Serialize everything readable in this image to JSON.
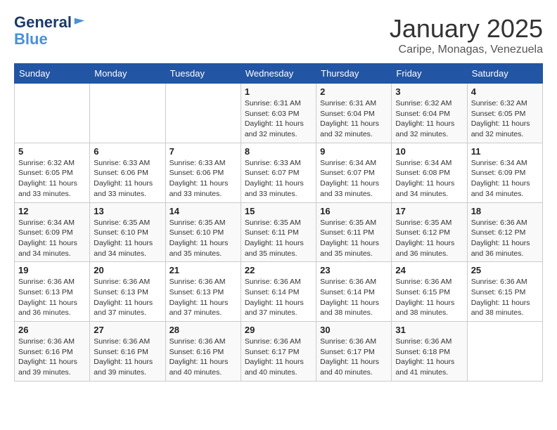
{
  "logo": {
    "line1": "General",
    "line2": "Blue"
  },
  "title": "January 2025",
  "subtitle": "Caripe, Monagas, Venezuela",
  "days_of_week": [
    "Sunday",
    "Monday",
    "Tuesday",
    "Wednesday",
    "Thursday",
    "Friday",
    "Saturday"
  ],
  "weeks": [
    [
      {
        "day": "",
        "info": ""
      },
      {
        "day": "",
        "info": ""
      },
      {
        "day": "",
        "info": ""
      },
      {
        "day": "1",
        "info": "Sunrise: 6:31 AM\nSunset: 6:03 PM\nDaylight: 11 hours\nand 32 minutes."
      },
      {
        "day": "2",
        "info": "Sunrise: 6:31 AM\nSunset: 6:04 PM\nDaylight: 11 hours\nand 32 minutes."
      },
      {
        "day": "3",
        "info": "Sunrise: 6:32 AM\nSunset: 6:04 PM\nDaylight: 11 hours\nand 32 minutes."
      },
      {
        "day": "4",
        "info": "Sunrise: 6:32 AM\nSunset: 6:05 PM\nDaylight: 11 hours\nand 32 minutes."
      }
    ],
    [
      {
        "day": "5",
        "info": "Sunrise: 6:32 AM\nSunset: 6:05 PM\nDaylight: 11 hours\nand 33 minutes."
      },
      {
        "day": "6",
        "info": "Sunrise: 6:33 AM\nSunset: 6:06 PM\nDaylight: 11 hours\nand 33 minutes."
      },
      {
        "day": "7",
        "info": "Sunrise: 6:33 AM\nSunset: 6:06 PM\nDaylight: 11 hours\nand 33 minutes."
      },
      {
        "day": "8",
        "info": "Sunrise: 6:33 AM\nSunset: 6:07 PM\nDaylight: 11 hours\nand 33 minutes."
      },
      {
        "day": "9",
        "info": "Sunrise: 6:34 AM\nSunset: 6:07 PM\nDaylight: 11 hours\nand 33 minutes."
      },
      {
        "day": "10",
        "info": "Sunrise: 6:34 AM\nSunset: 6:08 PM\nDaylight: 11 hours\nand 34 minutes."
      },
      {
        "day": "11",
        "info": "Sunrise: 6:34 AM\nSunset: 6:09 PM\nDaylight: 11 hours\nand 34 minutes."
      }
    ],
    [
      {
        "day": "12",
        "info": "Sunrise: 6:34 AM\nSunset: 6:09 PM\nDaylight: 11 hours\nand 34 minutes."
      },
      {
        "day": "13",
        "info": "Sunrise: 6:35 AM\nSunset: 6:10 PM\nDaylight: 11 hours\nand 34 minutes."
      },
      {
        "day": "14",
        "info": "Sunrise: 6:35 AM\nSunset: 6:10 PM\nDaylight: 11 hours\nand 35 minutes."
      },
      {
        "day": "15",
        "info": "Sunrise: 6:35 AM\nSunset: 6:11 PM\nDaylight: 11 hours\nand 35 minutes."
      },
      {
        "day": "16",
        "info": "Sunrise: 6:35 AM\nSunset: 6:11 PM\nDaylight: 11 hours\nand 35 minutes."
      },
      {
        "day": "17",
        "info": "Sunrise: 6:35 AM\nSunset: 6:12 PM\nDaylight: 11 hours\nand 36 minutes."
      },
      {
        "day": "18",
        "info": "Sunrise: 6:36 AM\nSunset: 6:12 PM\nDaylight: 11 hours\nand 36 minutes."
      }
    ],
    [
      {
        "day": "19",
        "info": "Sunrise: 6:36 AM\nSunset: 6:13 PM\nDaylight: 11 hours\nand 36 minutes."
      },
      {
        "day": "20",
        "info": "Sunrise: 6:36 AM\nSunset: 6:13 PM\nDaylight: 11 hours\nand 37 minutes."
      },
      {
        "day": "21",
        "info": "Sunrise: 6:36 AM\nSunset: 6:13 PM\nDaylight: 11 hours\nand 37 minutes."
      },
      {
        "day": "22",
        "info": "Sunrise: 6:36 AM\nSunset: 6:14 PM\nDaylight: 11 hours\nand 37 minutes."
      },
      {
        "day": "23",
        "info": "Sunrise: 6:36 AM\nSunset: 6:14 PM\nDaylight: 11 hours\nand 38 minutes."
      },
      {
        "day": "24",
        "info": "Sunrise: 6:36 AM\nSunset: 6:15 PM\nDaylight: 11 hours\nand 38 minutes."
      },
      {
        "day": "25",
        "info": "Sunrise: 6:36 AM\nSunset: 6:15 PM\nDaylight: 11 hours\nand 38 minutes."
      }
    ],
    [
      {
        "day": "26",
        "info": "Sunrise: 6:36 AM\nSunset: 6:16 PM\nDaylight: 11 hours\nand 39 minutes."
      },
      {
        "day": "27",
        "info": "Sunrise: 6:36 AM\nSunset: 6:16 PM\nDaylight: 11 hours\nand 39 minutes."
      },
      {
        "day": "28",
        "info": "Sunrise: 6:36 AM\nSunset: 6:16 PM\nDaylight: 11 hours\nand 40 minutes."
      },
      {
        "day": "29",
        "info": "Sunrise: 6:36 AM\nSunset: 6:17 PM\nDaylight: 11 hours\nand 40 minutes."
      },
      {
        "day": "30",
        "info": "Sunrise: 6:36 AM\nSunset: 6:17 PM\nDaylight: 11 hours\nand 40 minutes."
      },
      {
        "day": "31",
        "info": "Sunrise: 6:36 AM\nSunset: 6:18 PM\nDaylight: 11 hours\nand 41 minutes."
      },
      {
        "day": "",
        "info": ""
      }
    ]
  ]
}
